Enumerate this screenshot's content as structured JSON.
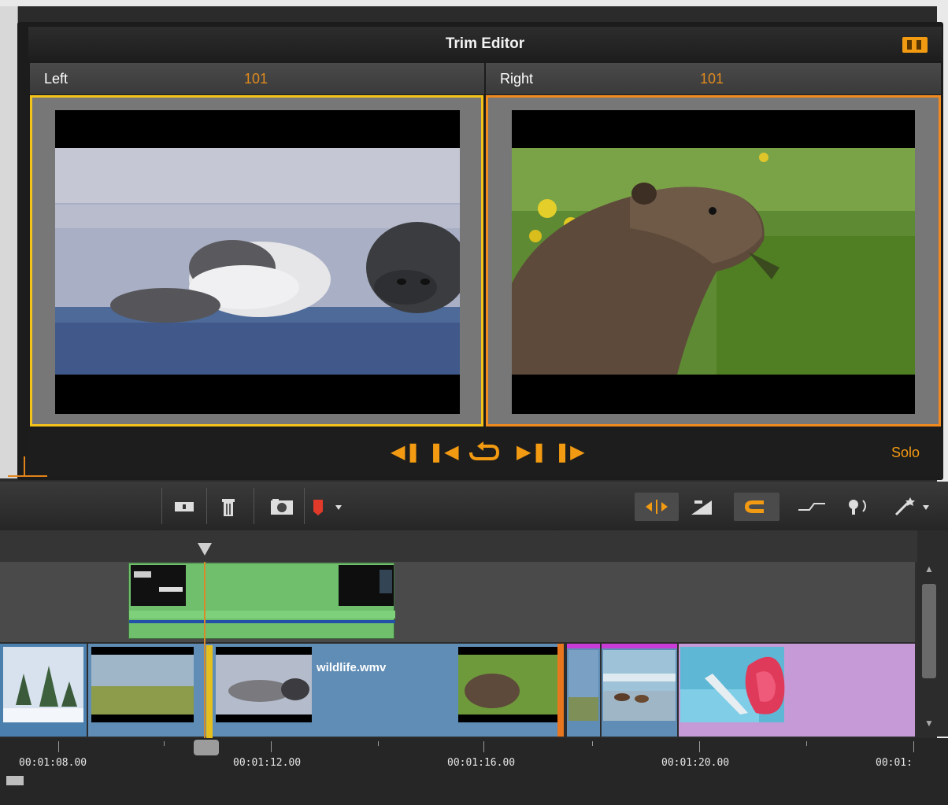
{
  "window": {
    "title": "Trim Editor"
  },
  "panes": {
    "left": {
      "label": "Left",
      "value": "101"
    },
    "right": {
      "label": "Right",
      "value": "101"
    }
  },
  "transport": {
    "buttons": [
      "skip-to-start",
      "step-back",
      "loop",
      "step-forward",
      "skip-to-end"
    ],
    "solo_label": "Solo"
  },
  "toolbar": {
    "left_tools": [
      "razor-icon",
      "trash-icon",
      "snapshot-icon",
      "marker-icon"
    ],
    "right_tools": [
      "trim-mode-icon",
      "dynamic-length-icon",
      "magnet-icon",
      "audio-scrub-icon",
      "voice-over-icon",
      "wand-icon"
    ]
  },
  "timeline": {
    "clip_name": "wildlife.wmv",
    "timecodes": [
      "00:01:08.00",
      "00:01:12.00",
      "00:01:16.00",
      "00:01:20.00",
      "00:01:"
    ]
  },
  "colors": {
    "accent": "#f29a11",
    "left_border": "#f4c31a",
    "right_border": "#f0891e",
    "overlay_clip": "#6fbf6c",
    "video_track": "#5f8db5",
    "purple_clip": "#c69ad6"
  }
}
